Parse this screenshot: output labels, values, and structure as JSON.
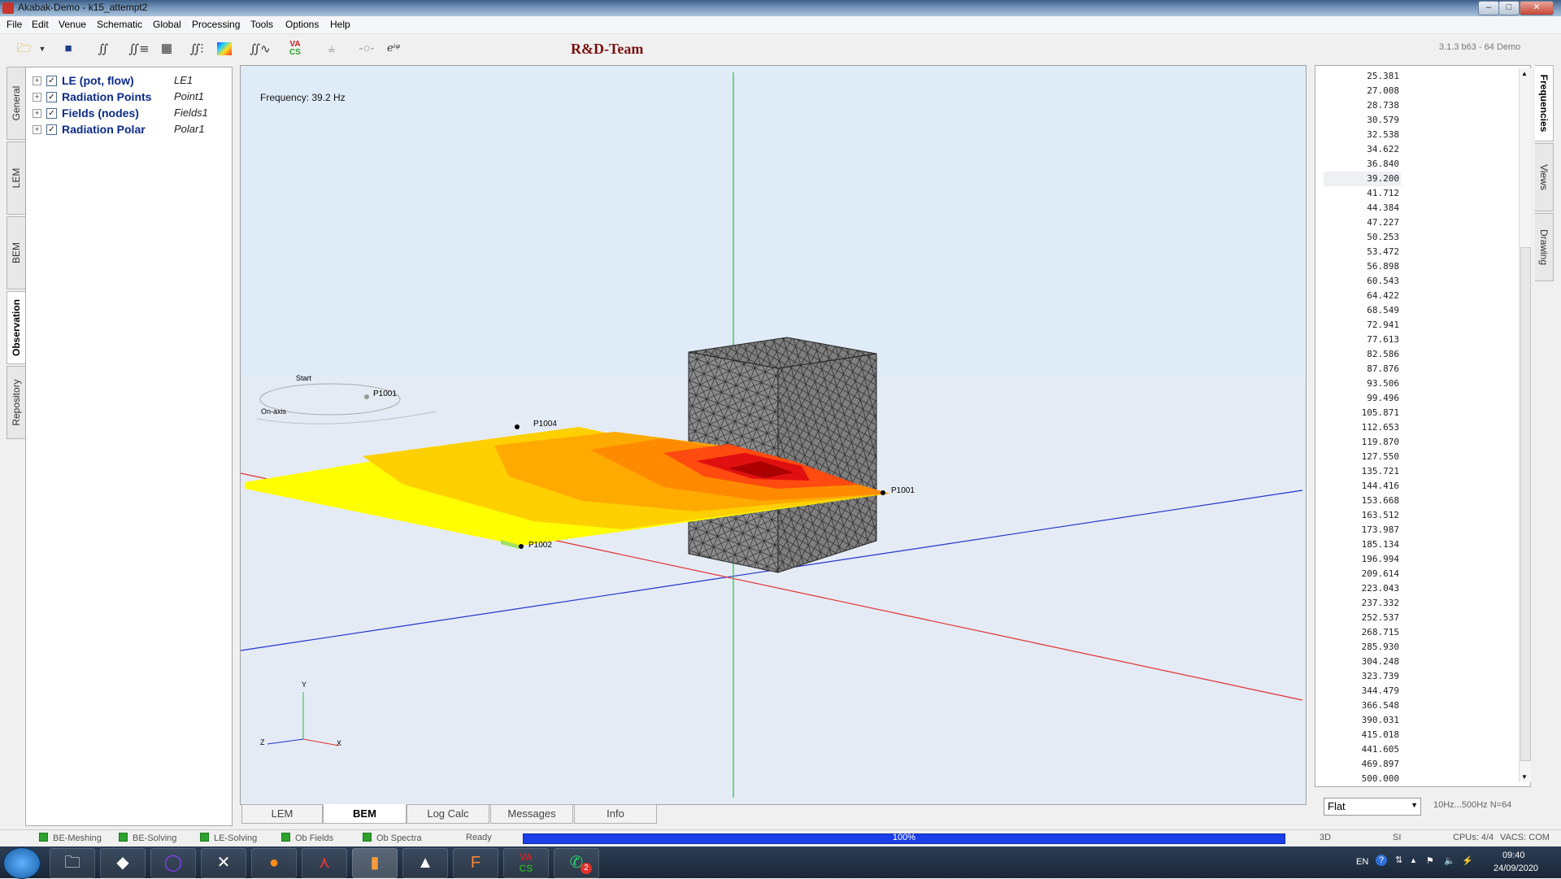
{
  "window": {
    "title": "Akabak-Demo - k15_attempt2"
  },
  "menu": [
    "File",
    "Edit",
    "Venue",
    "Schematic",
    "Global",
    "Processing",
    "Tools",
    "Options",
    "Help"
  ],
  "toolbar": {
    "brand": "R&D-Team",
    "version": "3.1.3 b63 - 64 Demo",
    "icons": [
      "open-folder-icon",
      "dropdown-icon",
      "save-icon",
      "integral-icon",
      "integral-list-icon",
      "mesh-icon",
      "integral-bars-icon",
      "color-map-icon",
      "integral-curve-icon",
      "vacs-icon",
      "component-icon",
      "circuit-icon",
      "complex-exp-icon"
    ],
    "vacs_label_top": "VA",
    "vacs_label_bottom": "CS",
    "exp_label": "eⁱᵠ"
  },
  "left_tabs": [
    "General",
    "LEM",
    "BEM",
    "Observation",
    "Repository"
  ],
  "tree": [
    {
      "name": "LE (pot, flow)",
      "sub": "LE1"
    },
    {
      "name": "Radiation Points",
      "sub": "Point1"
    },
    {
      "name": "Fields (nodes)",
      "sub": "Fields1"
    },
    {
      "name": "Radiation Polar",
      "sub": "Polar1"
    }
  ],
  "viewport": {
    "frequency_label": "Frequency: 39.2 Hz",
    "points": [
      "P1001",
      "P1004",
      "P1002",
      "P1001"
    ],
    "polar_labels": [
      "Start",
      "On-axis"
    ],
    "axes_labels": [
      "Y",
      "Z",
      "X"
    ]
  },
  "bottom_tabs": [
    "LEM",
    "BEM",
    "Log Calc",
    "Messages",
    "Info"
  ],
  "frequencies": [
    "25.381",
    "27.008",
    "28.738",
    "30.579",
    "32.538",
    "34.622",
    "36.840",
    "39.200",
    "41.712",
    "44.384",
    "47.227",
    "50.253",
    "53.472",
    "56.898",
    "60.543",
    "64.422",
    "68.549",
    "72.941",
    "77.613",
    "82.586",
    "87.876",
    "93.506",
    "99.496",
    "105.871",
    "112.653",
    "119.870",
    "127.550",
    "135.721",
    "144.416",
    "153.668",
    "163.512",
    "173.987",
    "185.134",
    "196.994",
    "209.614",
    "223.043",
    "237.332",
    "252.537",
    "268.715",
    "285.930",
    "304.248",
    "323.739",
    "344.479",
    "366.548",
    "390.031",
    "415.018",
    "441.605",
    "469.897",
    "500.000"
  ],
  "selected_frequency": "39.200",
  "right_tabs": [
    "Frequencies",
    "Views",
    "Drawing"
  ],
  "freq_controls": {
    "mode": "Flat",
    "range": "10Hz...500Hz  N=64"
  },
  "statusbar": {
    "items": [
      "BE-Meshing",
      "BE-Solving",
      "LE-Solving",
      "Ob Fields",
      "Ob Spectra"
    ],
    "ready": "Ready",
    "progress": "100%",
    "right": [
      "3D",
      "SI",
      "CPUs: 4/4",
      "VACS: COM"
    ]
  },
  "taskbar": {
    "lang": "EN",
    "time": "09:40",
    "date": "24/09/2020",
    "whatsapp_badge": "2"
  }
}
